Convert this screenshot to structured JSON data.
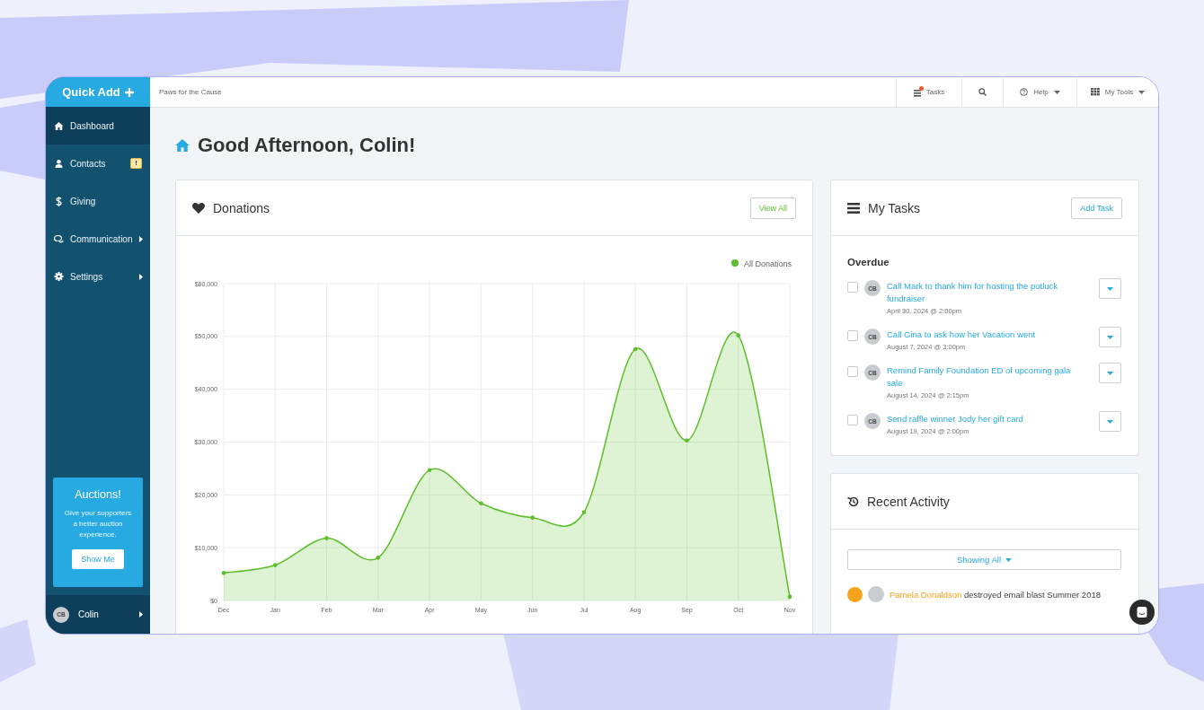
{
  "quick_add": {
    "label": "Quick Add"
  },
  "sidebar": {
    "items": [
      {
        "kind": "dashboard",
        "label": "Dashboard",
        "selected": true,
        "submenu": false
      },
      {
        "kind": "contacts",
        "label": "Contacts",
        "selected": false,
        "submenu": false,
        "badge": "!"
      },
      {
        "kind": "giving",
        "label": "Giving",
        "selected": false,
        "submenu": false
      },
      {
        "kind": "communication",
        "label": "Communication",
        "selected": false,
        "submenu": true
      },
      {
        "kind": "settings",
        "label": "Settings",
        "selected": false,
        "submenu": true
      }
    ],
    "promo": {
      "title": "Auctions!",
      "text": "Give your supporters a better auction experience.",
      "button": "Show Me"
    },
    "user": {
      "initials": "CB",
      "name": "Colin"
    }
  },
  "top_bar": {
    "organization": "Paws for the Cause",
    "items": [
      {
        "kind": "tasks",
        "label": "Tasks",
        "alert": true,
        "dropdown": false
      },
      {
        "kind": "search",
        "alert": false,
        "dropdown": false
      },
      {
        "kind": "help",
        "label": "Help",
        "alert": false,
        "dropdown": true
      },
      {
        "kind": "tools",
        "label": "My Tools",
        "alert": false,
        "dropdown": true
      }
    ]
  },
  "greeting": "Good Afternoon, Colin!",
  "donations": {
    "title": "Donations",
    "button": "View All",
    "chart_data": {
      "type": "area",
      "categories": [
        "Dec",
        "Jan",
        "Feb",
        "Mar",
        "Apr",
        "May",
        "Jun",
        "Jul",
        "Aug",
        "Sep",
        "Oct",
        "Nov"
      ],
      "series": [
        {
          "name": "All Donations",
          "color": "#5cbf2a",
          "values": [
            5200,
            6700,
            11800,
            8100,
            24700,
            18400,
            15700,
            16700,
            47600,
            30300,
            50200,
            700
          ]
        }
      ],
      "ylim": [
        0,
        60000
      ],
      "grid": true,
      "yticks": [
        {
          "value": 0,
          "label": "$0"
        },
        {
          "value": 10000,
          "label": "$10,000"
        },
        {
          "value": 20000,
          "label": "$20,000"
        },
        {
          "value": 30000,
          "label": "$30,000"
        },
        {
          "value": 40000,
          "label": "$40,000"
        },
        {
          "value": 50000,
          "label": "$50,000"
        },
        {
          "value": 60000,
          "label": "$60,000"
        }
      ]
    }
  },
  "tasks": {
    "title": "My Tasks",
    "button": "Add Task",
    "group": "Overdue",
    "items": [
      {
        "initials": "CB",
        "title": "Call Mark to thank him for hosting the potluck fundraiser",
        "due": "April 30, 2024 @ 2:00pm",
        "checked": false
      },
      {
        "initials": "CB",
        "title": "Call Gina to ask how her Vacation went",
        "due": "August 7, 2024 @ 3:00pm",
        "checked": false
      },
      {
        "initials": "CB",
        "title": "Remind Family Foundation ED of upcoming gala sale",
        "due": "August 14, 2024 @ 2:15pm",
        "checked": false
      },
      {
        "initials": "CB",
        "title": "Send raffle winner Jody her gift card",
        "due": "August 19, 2024 @ 2:00pm",
        "checked": false
      }
    ]
  },
  "recent_activity": {
    "title": "Recent Activity",
    "filter": "Showing All",
    "items": [
      {
        "actor": "Pamela Donaldson",
        "action": "destroyed email blast Summer 2018"
      }
    ]
  }
}
